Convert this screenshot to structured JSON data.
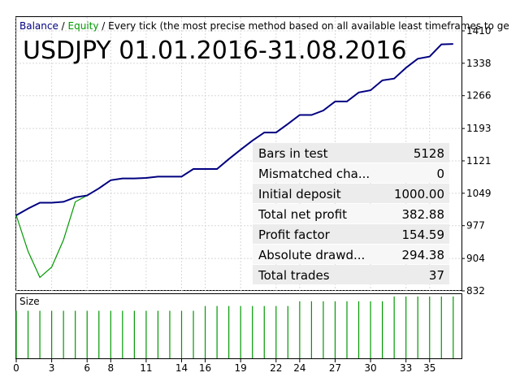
{
  "header": {
    "legend_balance": "Balance",
    "legend_sep": " / ",
    "legend_equity": "Equity",
    "legend_rest": " / Every tick (the most precise method based on all available least timeframes to ge",
    "title": "USDJPY 01.01.2016-31.08.2016"
  },
  "colors": {
    "balance": "#000080",
    "equity": "#009900",
    "size_bars": "#009900",
    "grid": "#d8d8d8",
    "axis": "#000000",
    "stats_bg": "#ececec",
    "stats_alt": "#f7f7f7"
  },
  "stats": [
    {
      "label": "Bars in test",
      "value": "5128"
    },
    {
      "label": "Mismatched cha...",
      "value": "0"
    },
    {
      "label": "Initial deposit",
      "value": "1000.00"
    },
    {
      "label": "Total net profit",
      "value": "382.88"
    },
    {
      "label": "Profit factor",
      "value": "154.59"
    },
    {
      "label": "Absolute drawd...",
      "value": "294.38"
    },
    {
      "label": "Total trades",
      "value": "37"
    }
  ],
  "chart_data": [
    {
      "type": "line",
      "xlim": [
        0,
        37.7
      ],
      "ylim": [
        832,
        1410
      ],
      "y_ticks": [
        1410,
        1338,
        1266,
        1193,
        1121,
        1049,
        977,
        904,
        832
      ],
      "grid": true,
      "series": [
        {
          "name": "Balance",
          "x": [
            0,
            1,
            2,
            3,
            4,
            5,
            6,
            7,
            8,
            9,
            10,
            11,
            12,
            13,
            14,
            15,
            16,
            17,
            18,
            19,
            20,
            21,
            22,
            23,
            24,
            25,
            26,
            27,
            28,
            29,
            30,
            31,
            32,
            33,
            34,
            35,
            36,
            37
          ],
          "values": [
            1000,
            1015,
            1028,
            1028,
            1030,
            1040,
            1044,
            1060,
            1078,
            1082,
            1082,
            1083,
            1086,
            1086,
            1086,
            1103,
            1103,
            1103,
            1125,
            1146,
            1166,
            1184,
            1184,
            1203,
            1223,
            1223,
            1233,
            1253,
            1253,
            1273,
            1278,
            1300,
            1304,
            1328,
            1348,
            1353,
            1380,
            1381
          ]
        },
        {
          "name": "Equity",
          "x": [
            0,
            1,
            2,
            3,
            4,
            5,
            6
          ],
          "values": [
            1000,
            920,
            862,
            885,
            945,
            1030,
            1044
          ]
        }
      ]
    },
    {
      "type": "bar",
      "title": "Size",
      "x": [
        0,
        1,
        2,
        3,
        4,
        5,
        6,
        7,
        8,
        9,
        10,
        11,
        12,
        13,
        14,
        15,
        16,
        17,
        18,
        19,
        20,
        21,
        22,
        23,
        24,
        25,
        26,
        27,
        28,
        29,
        30,
        31,
        32,
        33,
        34,
        35,
        36,
        37
      ],
      "values": [
        0.1,
        0.1,
        0.1,
        0.1,
        0.1,
        0.1,
        0.1,
        0.1,
        0.1,
        0.1,
        0.1,
        0.1,
        0.1,
        0.1,
        0.1,
        0.1,
        0.11,
        0.11,
        0.11,
        0.11,
        0.11,
        0.11,
        0.11,
        0.11,
        0.12,
        0.12,
        0.12,
        0.12,
        0.12,
        0.12,
        0.12,
        0.12,
        0.13,
        0.13,
        0.13,
        0.13,
        0.13,
        0.13
      ],
      "ylim": [
        0,
        0.135
      ],
      "x_ticks": [
        0,
        3,
        6,
        8,
        11,
        14,
        16,
        19,
        22,
        24,
        27,
        30,
        33,
        35
      ]
    }
  ]
}
